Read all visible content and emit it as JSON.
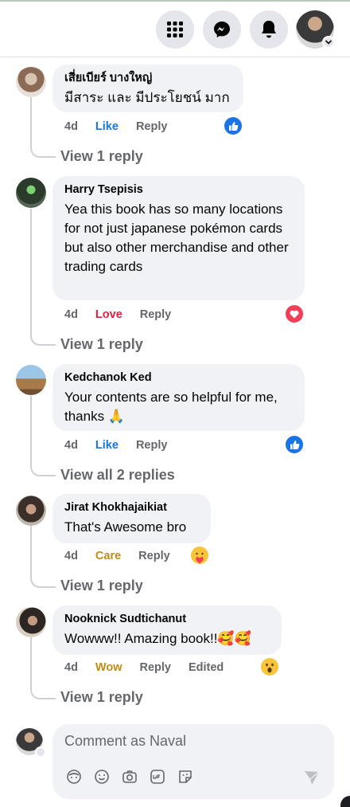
{
  "composer": {
    "placeholder": "Comment as Naval"
  },
  "comments": [
    {
      "author": "เสี่ยเบียร์ บางใหญ่",
      "text": "มีสาระ และ มีประโยชน์ มาก",
      "time": "4d",
      "reaction_label": "Like",
      "reaction_type": "like",
      "reply": "Reply",
      "replies_link": "View 1 reply",
      "edited": ""
    },
    {
      "author": "Harry Tsepisis",
      "text": "Yea this book has so many locations for not just japanese pokémon cards but also other merchandise and other trading cards",
      "time": "4d",
      "reaction_label": "Love",
      "reaction_type": "love",
      "reply": "Reply",
      "replies_link": "View 1 reply",
      "edited": ""
    },
    {
      "author": "Kedchanok Ked",
      "text": "Your contents are so helpful for me, thanks 🙏",
      "time": "4d",
      "reaction_label": "Like",
      "reaction_type": "like",
      "reply": "Reply",
      "replies_link": "View all 2 replies",
      "edited": ""
    },
    {
      "author": "Jirat Khokhajaikiat",
      "text": "That's Awesome bro",
      "time": "4d",
      "reaction_label": "Care",
      "reaction_type": "care",
      "reply": "Reply",
      "replies_link": "View 1 reply",
      "edited": ""
    },
    {
      "author": "Nooknick Sudtichanut",
      "text": "Wowww!! Amazing book!!🥰🥰",
      "time": "4d",
      "reaction_label": "Wow",
      "reaction_type": "wow",
      "reply": "Reply",
      "replies_link": "View 1 reply",
      "edited": "Edited"
    }
  ],
  "icons": {
    "top_bar": [
      "menu-grid-icon",
      "messenger-icon",
      "bell-icon",
      "profile-avatar"
    ],
    "composer_tools": [
      "avatar-sticker-icon",
      "emoji-icon",
      "camera-icon",
      "gif-icon",
      "sticker-icon"
    ],
    "send": "send-icon"
  },
  "colors": {
    "like": "#1b74e4",
    "love": "#e41e3f",
    "care": "#c08c15",
    "wow": "#c08c15",
    "bubble": "#f0f2f5",
    "meta": "#65676b"
  }
}
